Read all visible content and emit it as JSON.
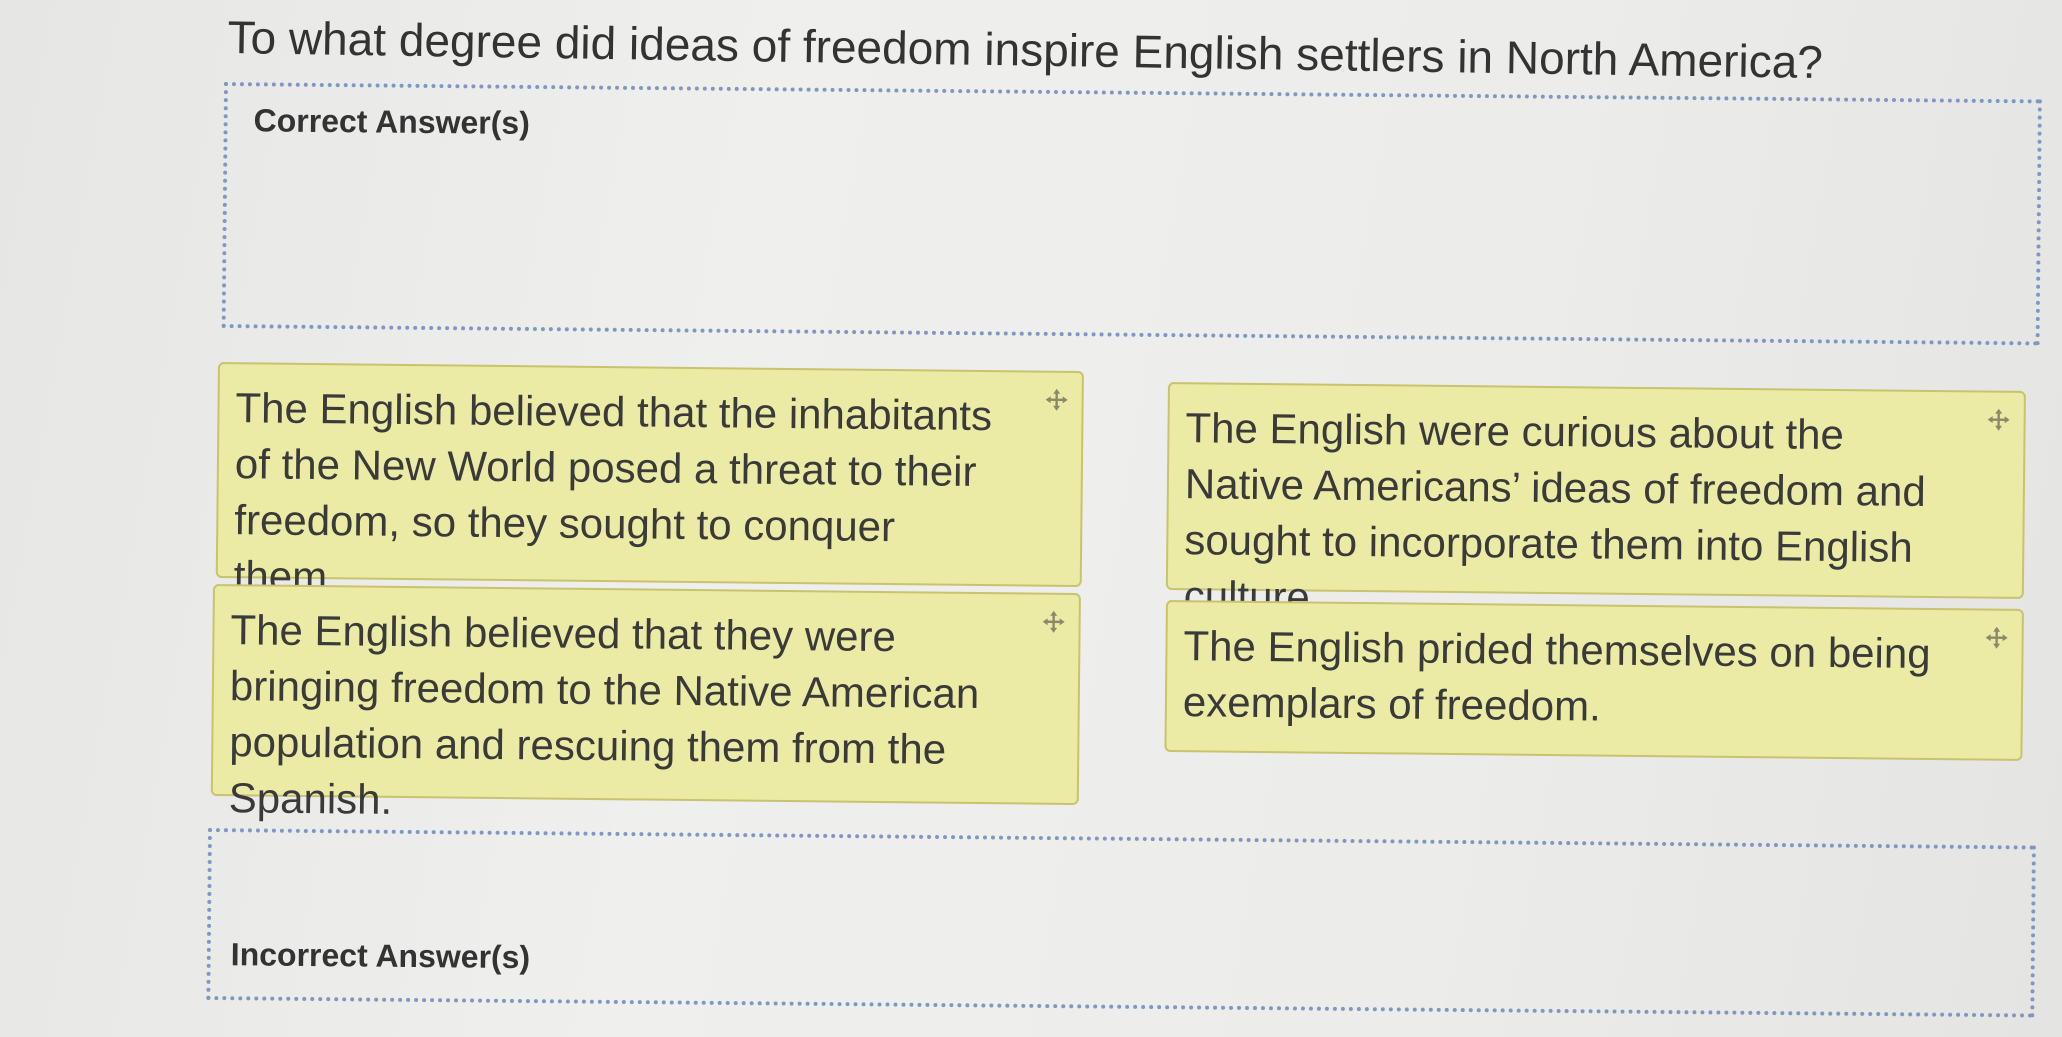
{
  "question": {
    "text": "To what degree did ideas of freedom inspire English settlers in North America?"
  },
  "dropzones": {
    "correct_label": "Correct Answer(s)",
    "incorrect_label": "Incorrect Answer(s)",
    "border_color": "#7f98c3"
  },
  "cards": [
    {
      "text": "The English believed that the inhabitants of the New World posed a threat to their freedom, so they sought to conquer them.",
      "icon": "move-icon"
    },
    {
      "text": "The English were curious about the Native Americans’ ideas of freedom and sought to incorporate them into English culture.",
      "icon": "move-icon"
    },
    {
      "text": "The English believed that they were bringing freedom to the Native American population and rescuing them from the Spanish.",
      "icon": "move-icon"
    },
    {
      "text": "The English prided themselves on being exemplars of freedom.",
      "icon": "move-icon"
    }
  ],
  "colors": {
    "card_background": "#ebeba5",
    "card_border": "#c9c36e",
    "page_background": "#ececea"
  }
}
